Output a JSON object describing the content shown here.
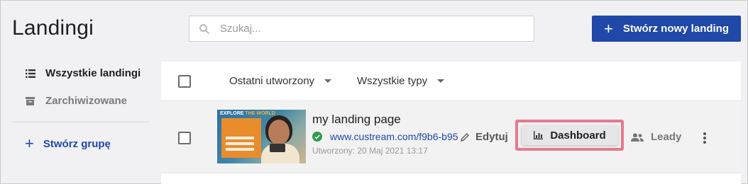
{
  "header": {
    "title": "Landingi",
    "search_placeholder": "Szukaj...",
    "create_button_label": "Stwórz nowy landing"
  },
  "sidebar": {
    "items": [
      {
        "label": "Wszystkie landingi",
        "icon": "list-icon",
        "active": true
      },
      {
        "label": "Zarchiwizowane",
        "icon": "archive-icon",
        "active": false
      }
    ],
    "create_group_label": "Stwórz grupę"
  },
  "filters": {
    "sort_label": "Ostatni utworzony",
    "type_label": "Wszystkie typy"
  },
  "landings": [
    {
      "title": "my landing page",
      "url": "www.custream.com/f9b6-b95",
      "created": "Utworzony: 20 Maj 2021 13:17",
      "status": "published",
      "thumbnail_text_1": "EXPLORE",
      "thumbnail_text_2": "THE WORLD",
      "actions": {
        "edit_label": "Edytuj",
        "dashboard_label": "Dashboard",
        "leads_label": "Leady"
      }
    }
  ],
  "colors": {
    "primary": "#2048a8",
    "success": "#2e9b4e",
    "highlight": "#e47a8e"
  }
}
